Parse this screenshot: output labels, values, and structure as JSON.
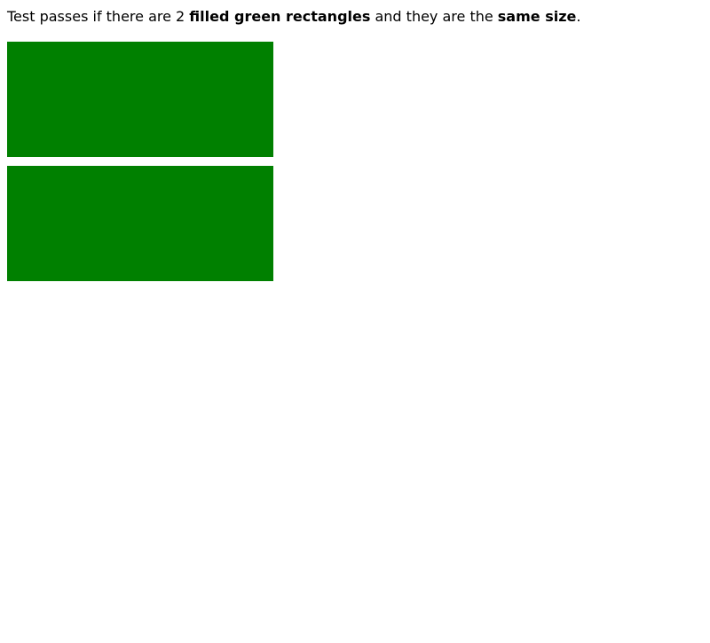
{
  "instruction": {
    "prefix": "Test passes if there are 2 ",
    "emphasis_1": "filled green rectangles",
    "middle": " and they are the ",
    "emphasis_2": "same size",
    "suffix": "."
  },
  "colors": {
    "rectangle_fill": "#008000"
  }
}
